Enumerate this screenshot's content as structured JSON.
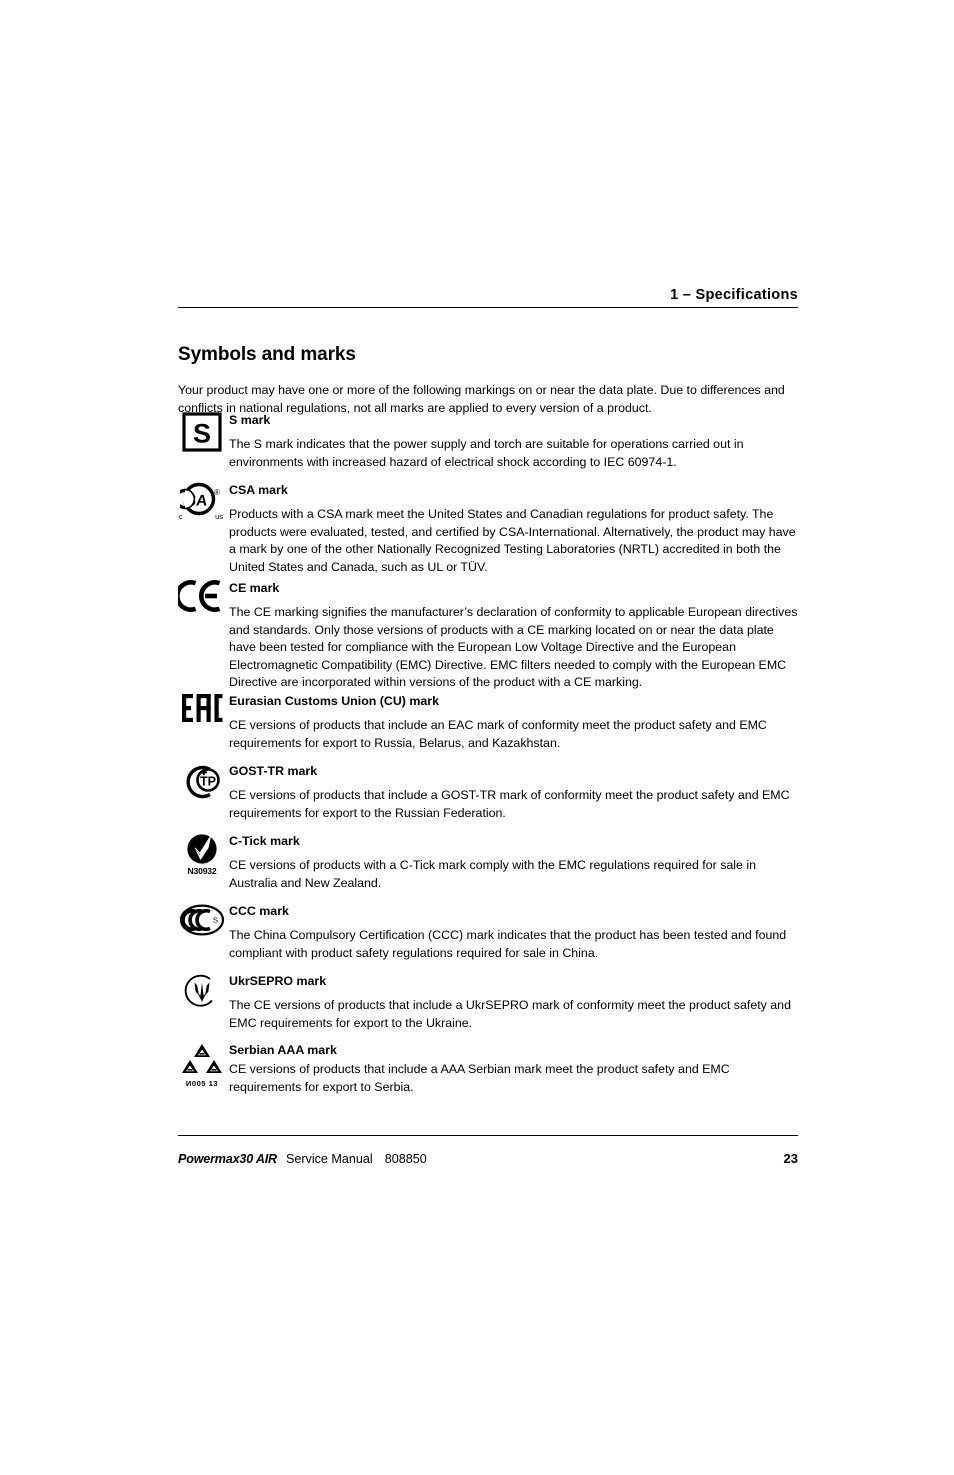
{
  "header": {
    "chapter_number": "1",
    "dash": "–",
    "chapter_title": "Specifications",
    "combined": "1  –  Specifications"
  },
  "section": {
    "title": "Symbols and marks",
    "intro": "Your product may have one or more of the following markings on or near the data plate. Due to differences and conflicts in national regulations, not all marks are applied to every version of a product."
  },
  "marks": [
    {
      "icon": "s-mark-icon",
      "heading": "S mark",
      "description": "The S mark indicates that the power supply and torch are suitable for operations carried out in environments with increased hazard of electrical shock according to IEC 60974-1."
    },
    {
      "icon": "csa-mark-icon",
      "heading": "CSA mark",
      "description": "Products with a CSA mark meet the United States and Canadian regulations for product safety. The products were evaluated, tested, and certified by CSA-International. Alternatively, the product may have a mark by one of the other Nationally Recognized Testing Laboratories (NRTL) accredited in both the United States and Canada, such as UL or TÜV.",
      "icon_labels": {
        "left": "c",
        "right": "us"
      }
    },
    {
      "icon": "ce-mark-icon",
      "heading": "CE mark",
      "description": "The CE marking signifies the manufacturer’s declaration of conformity to applicable European directives and standards. Only those versions of products with a CE marking located on or near the data plate have been tested for compliance with the European Low Voltage Directive and the European Electromagnetic Compatibility (EMC) Directive. EMC filters needed to comply with the European EMC Directive are incorporated within versions of the product with a CE marking."
    },
    {
      "icon": "eac-mark-icon",
      "heading": "Eurasian Customs Union (CU) mark",
      "description": "CE versions of products that include an EAC mark of conformity meet the product safety and EMC requirements for export to Russia, Belarus, and Kazakhstan."
    },
    {
      "icon": "gost-tr-mark-icon",
      "heading": "GOST-TR mark",
      "description": "CE versions of products that include a GOST-TR mark of conformity meet the product safety and EMC requirements for export to the Russian Federation."
    },
    {
      "icon": "c-tick-mark-icon",
      "heading": "C-Tick mark",
      "description": "CE versions of products with a C-Tick mark comply with the EMC regulations required for sale in Australia and New Zealand.",
      "icon_caption": "N30932"
    },
    {
      "icon": "ccc-mark-icon",
      "heading": "CCC mark",
      "description": "The China Compulsory Certification (CCC) mark indicates that the product has been tested and found compliant with product safety regulations required for sale in China."
    },
    {
      "icon": "ukrsepro-mark-icon",
      "heading": "UkrSEPRO mark",
      "description": "The CE versions of products that include a UkrSEPRO mark of conformity meet the product safety and EMC requirements for export to the Ukraine."
    },
    {
      "icon": "serbian-aaa-mark-icon",
      "heading": "Serbian AAA mark",
      "description": "CE versions of products that include a AAA Serbian mark meet the product safety and EMC requirements for export to Serbia.",
      "icon_caption": "И005  13"
    }
  ],
  "footer": {
    "product": "Powermax30 AIR",
    "document": "Service Manual",
    "document_number": "808850",
    "page_number": "23"
  },
  "colors": {
    "text": "#000000",
    "background": "#ffffff",
    "rule": "#000000"
  }
}
